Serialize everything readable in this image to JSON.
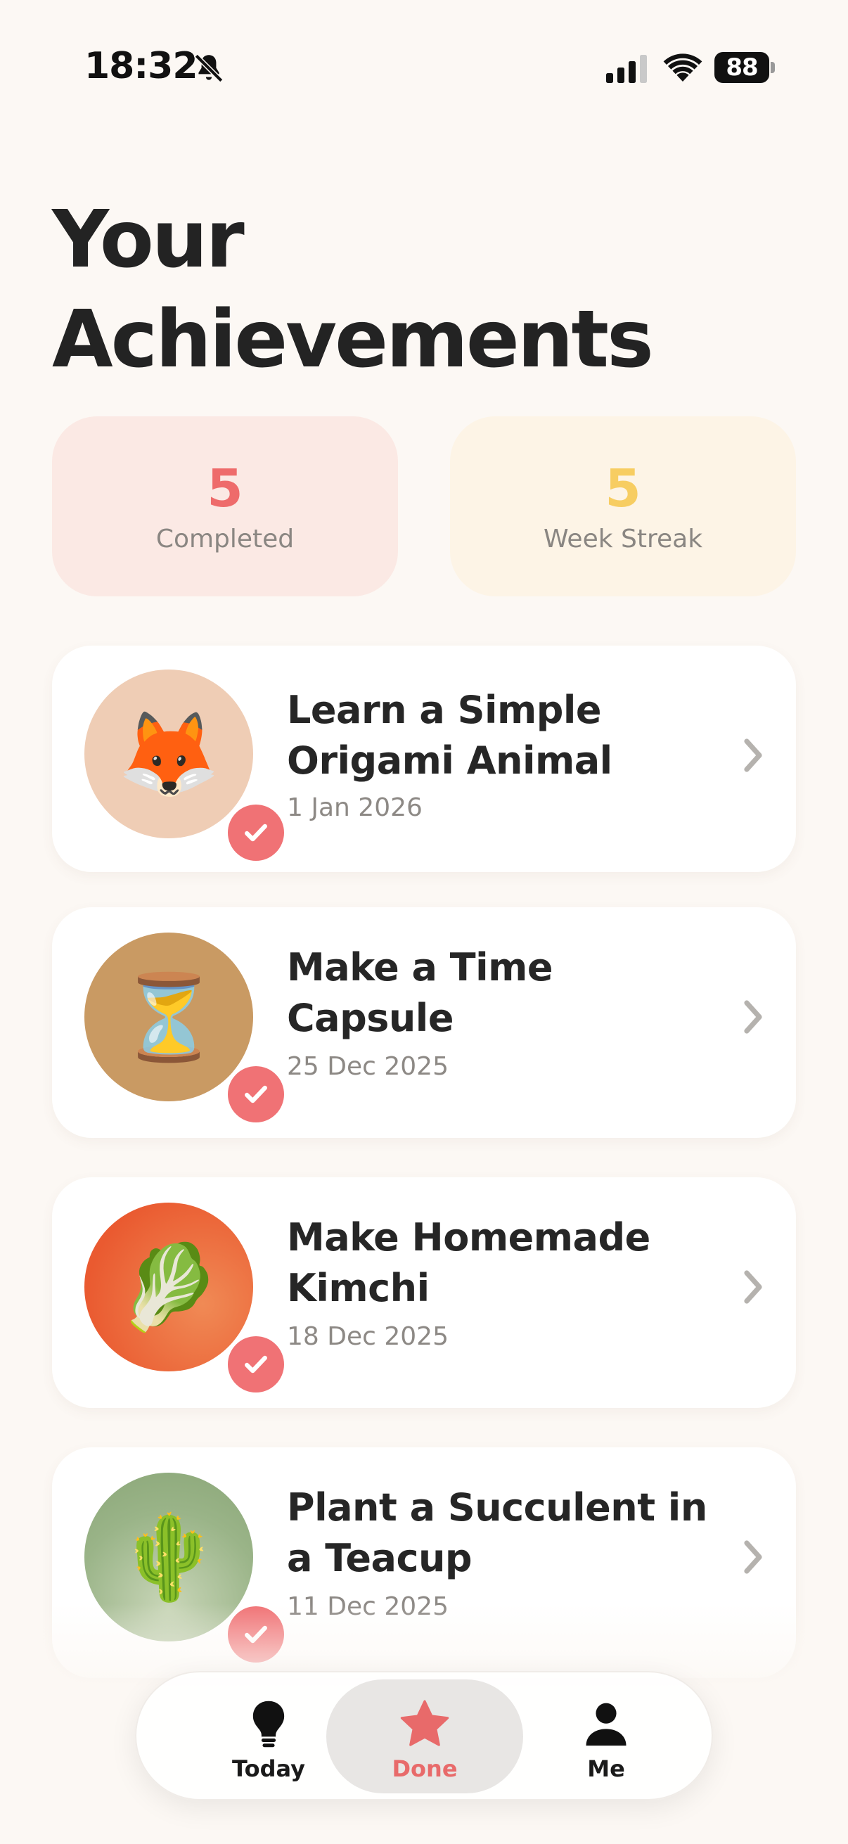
{
  "status_bar": {
    "time": "18:32",
    "battery": "88"
  },
  "header": {
    "title_line1": "Your",
    "title_line2": "Achievements"
  },
  "stats": {
    "completed": {
      "value": "5",
      "label": "Completed"
    },
    "streak": {
      "value": "5",
      "label": "Week Streak"
    }
  },
  "achievements": [
    {
      "title_line1": "Learn a Simple",
      "title_line2": "Origami Animal",
      "date": "1 Jan 2026",
      "emoji": "🦊",
      "icon": "fox-icon",
      "bg": "#efcdb5"
    },
    {
      "title_line1": "Make a Time",
      "title_line2": "Capsule",
      "date": "25 Dec 2025",
      "emoji": "⏳",
      "icon": "hourglass-icon",
      "bg": "#c99a63"
    },
    {
      "title_line1": "Make Homemade",
      "title_line2": "Kimchi",
      "date": "18 Dec 2025",
      "emoji": "🥬",
      "icon": "leafy-green-icon",
      "bg": "#ee6a3e"
    },
    {
      "title_line1": "Plant a Succulent in",
      "title_line2": "a Teacup",
      "date": "11 Dec 2025",
      "emoji": "🌵",
      "icon": "cactus-icon",
      "bg": "#9ab488"
    }
  ],
  "tab_bar": {
    "tabs": [
      {
        "label": "Today",
        "icon": "lightbulb-icon"
      },
      {
        "label": "Done",
        "icon": "star-icon",
        "selected": true
      },
      {
        "label": "Me",
        "icon": "person-icon"
      }
    ]
  },
  "colors": {
    "accent": "#ee6b6b",
    "streak": "#f7cd62",
    "background": "#fcf8f4",
    "check_badge": "#f07275"
  }
}
